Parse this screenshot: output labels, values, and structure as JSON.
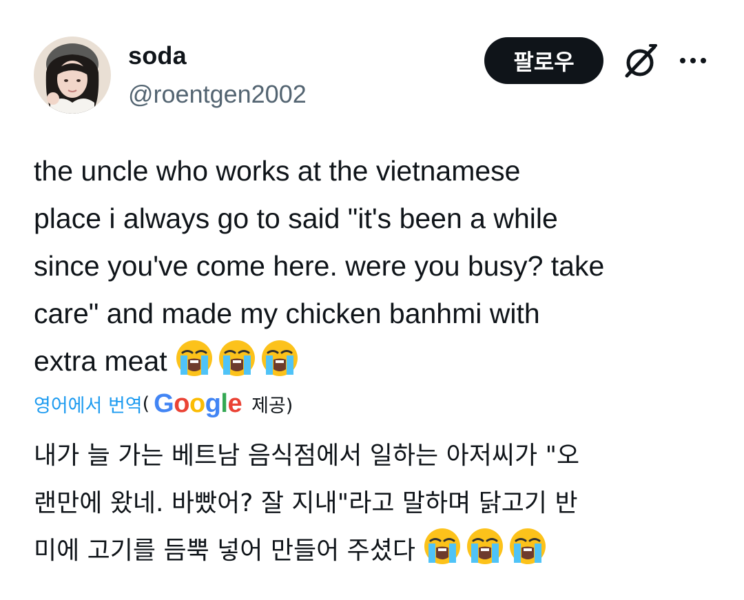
{
  "user": {
    "display_name": "soda",
    "handle": "@roentgen2002"
  },
  "actions": {
    "follow_label": "팔로우",
    "grok_icon": "grok-icon",
    "more_icon": "more-icon"
  },
  "tweet": {
    "text": "the uncle who works at the vietnamese\nplace i always go to said \"it's been a while\nsince you've come here. were you busy? take\ncare\" and made my chicken banhmi with\nextra meat ",
    "emoji_icon": "loudly-crying-face-icon",
    "emoji_count": 3
  },
  "translation": {
    "link_label": "영어에서 번역",
    "open_paren": "(",
    "provider": "Google",
    "provided_label": "제공)",
    "text": "내가 늘 가는 베트남 음식점에서 일하는 아저씨가 \"오\n랜만에 왔네. 바빴어? 잘 지내\"라고 말하며 닭고기 반\n미에 고기를 듬뿍 넣어 만들어 주셨다 "
  },
  "colors": {
    "link_blue": "#1d9bf0",
    "text_primary": "#0f1419",
    "text_secondary": "#536471",
    "button_dark": "#0f1419",
    "google_blue": "#4285F4",
    "google_red": "#EA4335",
    "google_yellow": "#FBBC05",
    "google_green": "#34A853"
  }
}
